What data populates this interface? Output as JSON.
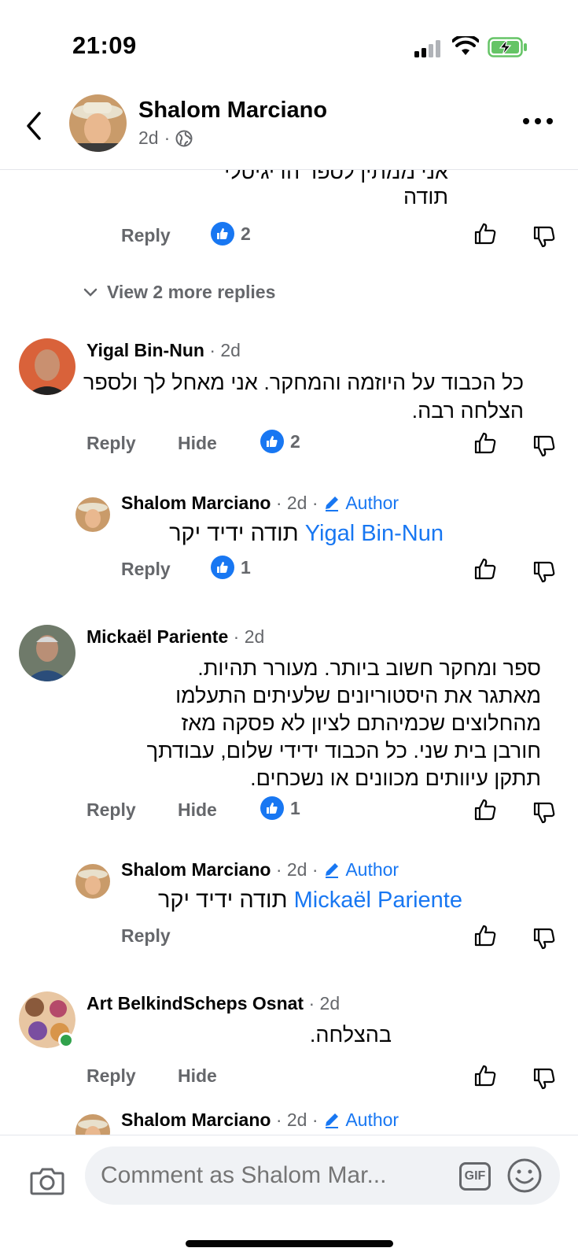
{
  "status": {
    "time": "21:09"
  },
  "header": {
    "name": "Shalom Marciano",
    "age": "2d",
    "sep": "·"
  },
  "colors": {
    "accent": "#1877f2",
    "muted": "#65676b"
  },
  "top_reply": {
    "lines": [
      "אני ממתין לספר הדיגיטלי",
      "תודה"
    ],
    "reply": "Reply",
    "likes": "2"
  },
  "view_more": "View 2 more replies",
  "comments": [
    {
      "name": "Yigal Bin-Nun",
      "age": "2d",
      "text": "כל הכבוד על היוזמה והמחקר. אני מאחל לך ולספר הצלחה רבה.",
      "reply": "Reply",
      "hide": "Hide",
      "likes": "2"
    },
    {
      "name": "Shalom Marciano",
      "age": "2d",
      "badge": "Author",
      "mention": "Yigal Bin-Nun",
      "text": "תודה ידיד יקר",
      "reply": "Reply",
      "likes": "1"
    },
    {
      "name": "Mickaël Pariente",
      "age": "2d",
      "lines": [
        "ספר ומחקר חשוב ביותר. מעורר תהיות.",
        "מאתגר את היסטוריונים שלעיתים התעלמו",
        "מהחלוצים שכמיהתם לציון לא פסקה מאז",
        "חורבן בית שני. כל הכבוד ידידי שלום, עבודתך",
        "תתקן עיוותים מכוונים או נשכחים."
      ],
      "reply": "Reply",
      "hide": "Hide",
      "likes": "1"
    },
    {
      "name": "Shalom Marciano",
      "age": "2d",
      "badge": "Author",
      "mention": "Mickaël Pariente",
      "text": "תודה ידיד יקר",
      "reply": "Reply"
    },
    {
      "name": "Art BelkindScheps Osnat",
      "age": "2d",
      "text": "בהצלחה.",
      "reply": "Reply",
      "hide": "Hide"
    },
    {
      "name": "Shalom Marciano",
      "age": "2d",
      "badge": "Author"
    }
  ],
  "composer": {
    "placeholder": "Comment as Shalom Mar...",
    "gif": "GIF"
  },
  "icons": [
    "back-icon",
    "globe-icon",
    "more-icon",
    "like-icon",
    "thumbs-up-icon",
    "thumbs-down-icon",
    "chevron-down-icon",
    "pencil-icon",
    "camera-icon",
    "gif-icon",
    "emoji-icon",
    "signal-icon",
    "wifi-icon",
    "battery-icon"
  ]
}
